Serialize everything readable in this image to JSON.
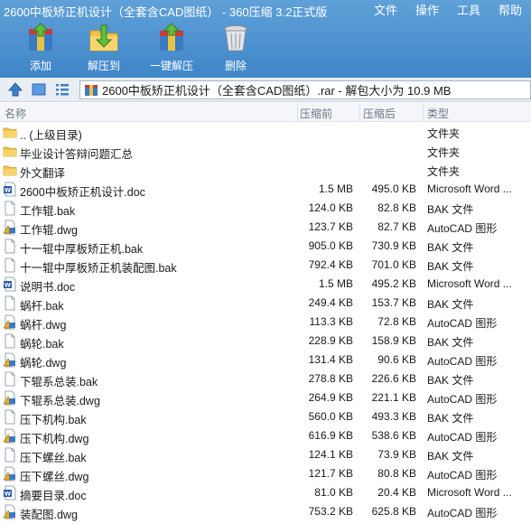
{
  "window": {
    "title": "2600中板矫正机设计（全套含CAD图纸） - 360压缩 3.2正式版"
  },
  "menu": [
    "文件",
    "操作",
    "工具",
    "帮助"
  ],
  "toolbar": [
    {
      "label": "添加",
      "icon": "add-archive-icon"
    },
    {
      "label": "解压到",
      "icon": "extract-to-icon"
    },
    {
      "label": "一键解压",
      "icon": "one-click-extract-icon"
    },
    {
      "label": "删除",
      "icon": "trash-icon"
    }
  ],
  "address": {
    "path": "2600中板矫正机设计（全套含CAD图纸）.rar - 解包大小为 10.9 MB"
  },
  "columns": {
    "name": "名称",
    "compressed": "压缩前",
    "uncompressed": "压缩后",
    "type": "类型"
  },
  "files": [
    {
      "name": ".. (上级目录)",
      "csize": "",
      "usize": "",
      "type": "文件夹",
      "icon": "folder"
    },
    {
      "name": "毕业设计答辩问题汇总",
      "csize": "",
      "usize": "",
      "type": "文件夹",
      "icon": "folder"
    },
    {
      "name": "外文翻译",
      "csize": "",
      "usize": "",
      "type": "文件夹",
      "icon": "folder"
    },
    {
      "name": "2600中板矫正机设计.doc",
      "csize": "1.5 MB",
      "usize": "495.0 KB",
      "type": "Microsoft Word ...",
      "icon": "doc"
    },
    {
      "name": "工作辊.bak",
      "csize": "124.0 KB",
      "usize": "82.8 KB",
      "type": "BAK 文件",
      "icon": "bak"
    },
    {
      "name": "工作辊.dwg",
      "csize": "123.7 KB",
      "usize": "82.7 KB",
      "type": "AutoCAD 图形",
      "icon": "dwg"
    },
    {
      "name": "十一辊中厚板矫正机.bak",
      "csize": "905.0 KB",
      "usize": "730.9 KB",
      "type": "BAK 文件",
      "icon": "bak"
    },
    {
      "name": "十一辊中厚板矫正机装配图.bak",
      "csize": "792.4 KB",
      "usize": "701.0 KB",
      "type": "BAK 文件",
      "icon": "bak"
    },
    {
      "name": "说明书.doc",
      "csize": "1.5 MB",
      "usize": "495.2 KB",
      "type": "Microsoft Word ...",
      "icon": "doc"
    },
    {
      "name": "蜗杆.bak",
      "csize": "249.4 KB",
      "usize": "153.7 KB",
      "type": "BAK 文件",
      "icon": "bak"
    },
    {
      "name": "蜗杆.dwg",
      "csize": "113.3 KB",
      "usize": "72.8 KB",
      "type": "AutoCAD 图形",
      "icon": "dwg"
    },
    {
      "name": "蜗轮.bak",
      "csize": "228.9 KB",
      "usize": "158.9 KB",
      "type": "BAK 文件",
      "icon": "bak"
    },
    {
      "name": "蜗轮.dwg",
      "csize": "131.4 KB",
      "usize": "90.6 KB",
      "type": "AutoCAD 图形",
      "icon": "dwg"
    },
    {
      "name": "下辊系总装.bak",
      "csize": "278.8 KB",
      "usize": "226.6 KB",
      "type": "BAK 文件",
      "icon": "bak"
    },
    {
      "name": "下辊系总装.dwg",
      "csize": "264.9 KB",
      "usize": "221.1 KB",
      "type": "AutoCAD 图形",
      "icon": "dwg"
    },
    {
      "name": "压下机构.bak",
      "csize": "560.0 KB",
      "usize": "493.3 KB",
      "type": "BAK 文件",
      "icon": "bak"
    },
    {
      "name": "压下机构.dwg",
      "csize": "616.9 KB",
      "usize": "538.6 KB",
      "type": "AutoCAD 图形",
      "icon": "dwg"
    },
    {
      "name": "压下螺丝.bak",
      "csize": "124.1 KB",
      "usize": "73.9 KB",
      "type": "BAK 文件",
      "icon": "bak"
    },
    {
      "name": "压下螺丝.dwg",
      "csize": "121.7 KB",
      "usize": "80.8 KB",
      "type": "AutoCAD 图形",
      "icon": "dwg"
    },
    {
      "name": "摘要目录.doc",
      "csize": "81.0 KB",
      "usize": "20.4 KB",
      "type": "Microsoft Word ...",
      "icon": "doc"
    },
    {
      "name": "装配图.dwg",
      "csize": "753.2 KB",
      "usize": "625.8 KB",
      "type": "AutoCAD 图形",
      "icon": "dwg"
    }
  ],
  "colors": {
    "titlebar": "#4a8fcf",
    "folder": "#f2c14a",
    "word": "#2a5caa",
    "autocad": "#e8b020"
  }
}
